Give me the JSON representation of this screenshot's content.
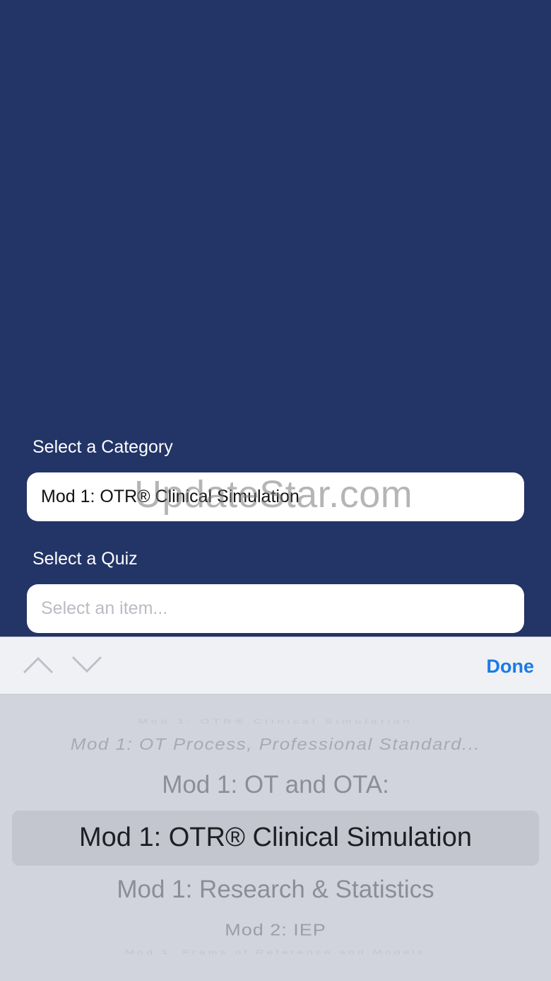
{
  "category": {
    "label": "Select a Category",
    "value": "Mod 1:  OTR® Clinical Simulation"
  },
  "quiz": {
    "label": "Select a Quiz",
    "placeholder": "Select an item..."
  },
  "watermark": "UpdateStar.com",
  "toolbar": {
    "prev_icon": "chevron-up-icon",
    "next_icon": "chevron-down-icon",
    "done_label": "Done"
  },
  "picker": {
    "options": [
      "Mod 1:  OTR® Clinical Simulation",
      "Mod 1:    OT Process, Professional Standard...",
      "Mod 1:  OT and OTA:",
      "Mod 1:  OTR® Clinical Simulation",
      "Mod 1:   Research & Statistics",
      "Mod 2: IEP",
      "Mod 1: Frams of Reference and Models"
    ],
    "selected_index": 3
  }
}
